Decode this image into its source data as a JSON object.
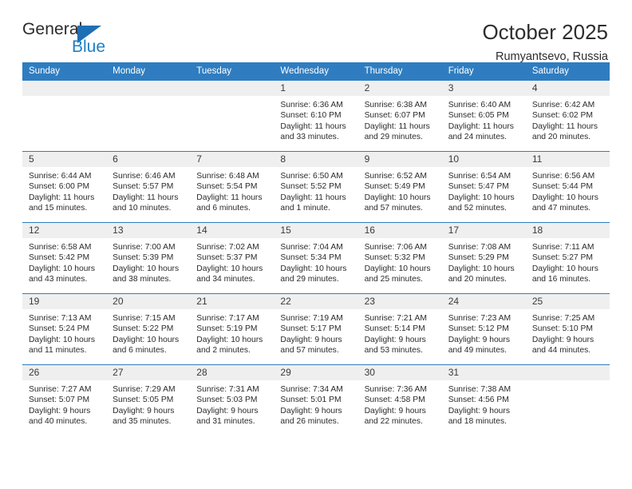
{
  "brand": {
    "word1": "General",
    "word2": "Blue",
    "flag_color": "#1f6fb5",
    "blue_color": "#1f7fc4"
  },
  "header": {
    "title": "October 2025",
    "location": "Rumyantsevo, Russia"
  },
  "theme": {
    "header_blue": "#2f7dc0",
    "daystrip_grey": "#efefef",
    "text": "#2b2b2b"
  },
  "weekdays": [
    "Sunday",
    "Monday",
    "Tuesday",
    "Wednesday",
    "Thursday",
    "Friday",
    "Saturday"
  ],
  "labels": {
    "sunrise": "Sunrise:",
    "sunset": "Sunset:",
    "daylight": "Daylight:"
  },
  "weeks": [
    [
      {
        "day": "",
        "empty": true
      },
      {
        "day": "",
        "empty": true
      },
      {
        "day": "",
        "empty": true
      },
      {
        "day": "1",
        "sunrise": "Sunrise: 6:36 AM",
        "sunset": "Sunset: 6:10 PM",
        "daylight1": "Daylight: 11 hours",
        "daylight2": "and 33 minutes."
      },
      {
        "day": "2",
        "sunrise": "Sunrise: 6:38 AM",
        "sunset": "Sunset: 6:07 PM",
        "daylight1": "Daylight: 11 hours",
        "daylight2": "and 29 minutes."
      },
      {
        "day": "3",
        "sunrise": "Sunrise: 6:40 AM",
        "sunset": "Sunset: 6:05 PM",
        "daylight1": "Daylight: 11 hours",
        "daylight2": "and 24 minutes."
      },
      {
        "day": "4",
        "sunrise": "Sunrise: 6:42 AM",
        "sunset": "Sunset: 6:02 PM",
        "daylight1": "Daylight: 11 hours",
        "daylight2": "and 20 minutes."
      }
    ],
    [
      {
        "day": "5",
        "sunrise": "Sunrise: 6:44 AM",
        "sunset": "Sunset: 6:00 PM",
        "daylight1": "Daylight: 11 hours",
        "daylight2": "and 15 minutes."
      },
      {
        "day": "6",
        "sunrise": "Sunrise: 6:46 AM",
        "sunset": "Sunset: 5:57 PM",
        "daylight1": "Daylight: 11 hours",
        "daylight2": "and 10 minutes."
      },
      {
        "day": "7",
        "sunrise": "Sunrise: 6:48 AM",
        "sunset": "Sunset: 5:54 PM",
        "daylight1": "Daylight: 11 hours",
        "daylight2": "and 6 minutes."
      },
      {
        "day": "8",
        "sunrise": "Sunrise: 6:50 AM",
        "sunset": "Sunset: 5:52 PM",
        "daylight1": "Daylight: 11 hours",
        "daylight2": "and 1 minute."
      },
      {
        "day": "9",
        "sunrise": "Sunrise: 6:52 AM",
        "sunset": "Sunset: 5:49 PM",
        "daylight1": "Daylight: 10 hours",
        "daylight2": "and 57 minutes."
      },
      {
        "day": "10",
        "sunrise": "Sunrise: 6:54 AM",
        "sunset": "Sunset: 5:47 PM",
        "daylight1": "Daylight: 10 hours",
        "daylight2": "and 52 minutes."
      },
      {
        "day": "11",
        "sunrise": "Sunrise: 6:56 AM",
        "sunset": "Sunset: 5:44 PM",
        "daylight1": "Daylight: 10 hours",
        "daylight2": "and 47 minutes."
      }
    ],
    [
      {
        "day": "12",
        "sunrise": "Sunrise: 6:58 AM",
        "sunset": "Sunset: 5:42 PM",
        "daylight1": "Daylight: 10 hours",
        "daylight2": "and 43 minutes."
      },
      {
        "day": "13",
        "sunrise": "Sunrise: 7:00 AM",
        "sunset": "Sunset: 5:39 PM",
        "daylight1": "Daylight: 10 hours",
        "daylight2": "and 38 minutes."
      },
      {
        "day": "14",
        "sunrise": "Sunrise: 7:02 AM",
        "sunset": "Sunset: 5:37 PM",
        "daylight1": "Daylight: 10 hours",
        "daylight2": "and 34 minutes."
      },
      {
        "day": "15",
        "sunrise": "Sunrise: 7:04 AM",
        "sunset": "Sunset: 5:34 PM",
        "daylight1": "Daylight: 10 hours",
        "daylight2": "and 29 minutes."
      },
      {
        "day": "16",
        "sunrise": "Sunrise: 7:06 AM",
        "sunset": "Sunset: 5:32 PM",
        "daylight1": "Daylight: 10 hours",
        "daylight2": "and 25 minutes."
      },
      {
        "day": "17",
        "sunrise": "Sunrise: 7:08 AM",
        "sunset": "Sunset: 5:29 PM",
        "daylight1": "Daylight: 10 hours",
        "daylight2": "and 20 minutes."
      },
      {
        "day": "18",
        "sunrise": "Sunrise: 7:11 AM",
        "sunset": "Sunset: 5:27 PM",
        "daylight1": "Daylight: 10 hours",
        "daylight2": "and 16 minutes."
      }
    ],
    [
      {
        "day": "19",
        "sunrise": "Sunrise: 7:13 AM",
        "sunset": "Sunset: 5:24 PM",
        "daylight1": "Daylight: 10 hours",
        "daylight2": "and 11 minutes."
      },
      {
        "day": "20",
        "sunrise": "Sunrise: 7:15 AM",
        "sunset": "Sunset: 5:22 PM",
        "daylight1": "Daylight: 10 hours",
        "daylight2": "and 6 minutes."
      },
      {
        "day": "21",
        "sunrise": "Sunrise: 7:17 AM",
        "sunset": "Sunset: 5:19 PM",
        "daylight1": "Daylight: 10 hours",
        "daylight2": "and 2 minutes."
      },
      {
        "day": "22",
        "sunrise": "Sunrise: 7:19 AM",
        "sunset": "Sunset: 5:17 PM",
        "daylight1": "Daylight: 9 hours",
        "daylight2": "and 57 minutes."
      },
      {
        "day": "23",
        "sunrise": "Sunrise: 7:21 AM",
        "sunset": "Sunset: 5:14 PM",
        "daylight1": "Daylight: 9 hours",
        "daylight2": "and 53 minutes."
      },
      {
        "day": "24",
        "sunrise": "Sunrise: 7:23 AM",
        "sunset": "Sunset: 5:12 PM",
        "daylight1": "Daylight: 9 hours",
        "daylight2": "and 49 minutes."
      },
      {
        "day": "25",
        "sunrise": "Sunrise: 7:25 AM",
        "sunset": "Sunset: 5:10 PM",
        "daylight1": "Daylight: 9 hours",
        "daylight2": "and 44 minutes."
      }
    ],
    [
      {
        "day": "26",
        "sunrise": "Sunrise: 7:27 AM",
        "sunset": "Sunset: 5:07 PM",
        "daylight1": "Daylight: 9 hours",
        "daylight2": "and 40 minutes."
      },
      {
        "day": "27",
        "sunrise": "Sunrise: 7:29 AM",
        "sunset": "Sunset: 5:05 PM",
        "daylight1": "Daylight: 9 hours",
        "daylight2": "and 35 minutes."
      },
      {
        "day": "28",
        "sunrise": "Sunrise: 7:31 AM",
        "sunset": "Sunset: 5:03 PM",
        "daylight1": "Daylight: 9 hours",
        "daylight2": "and 31 minutes."
      },
      {
        "day": "29",
        "sunrise": "Sunrise: 7:34 AM",
        "sunset": "Sunset: 5:01 PM",
        "daylight1": "Daylight: 9 hours",
        "daylight2": "and 26 minutes."
      },
      {
        "day": "30",
        "sunrise": "Sunrise: 7:36 AM",
        "sunset": "Sunset: 4:58 PM",
        "daylight1": "Daylight: 9 hours",
        "daylight2": "and 22 minutes."
      },
      {
        "day": "31",
        "sunrise": "Sunrise: 7:38 AM",
        "sunset": "Sunset: 4:56 PM",
        "daylight1": "Daylight: 9 hours",
        "daylight2": "and 18 minutes."
      },
      {
        "day": "",
        "empty": true
      }
    ]
  ]
}
